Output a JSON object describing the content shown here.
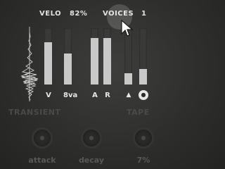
{
  "header": {
    "velo_label": "VELO",
    "velo_value": "82%",
    "voices_label": "VOICES",
    "voices_value": "1"
  },
  "sliders": [
    {
      "label": "V",
      "level": 0.75
    },
    {
      "label": "8va",
      "level": 0.55
    },
    {
      "label": "A",
      "level": 0.82
    },
    {
      "label": "R",
      "level": 0.82
    },
    {
      "label": "▲",
      "level": 0.2
    },
    {
      "label": "●",
      "level": 0.27
    }
  ],
  "sections": {
    "transient": "TRANSIENT",
    "tape": "TAPE"
  },
  "knobs": [
    {
      "label": "attack"
    },
    {
      "label": "decay"
    },
    {
      "label": "7%"
    }
  ],
  "colors": {
    "fill": "#c9c9c9",
    "track": "#3a3a39",
    "section": "#4a4a48"
  }
}
